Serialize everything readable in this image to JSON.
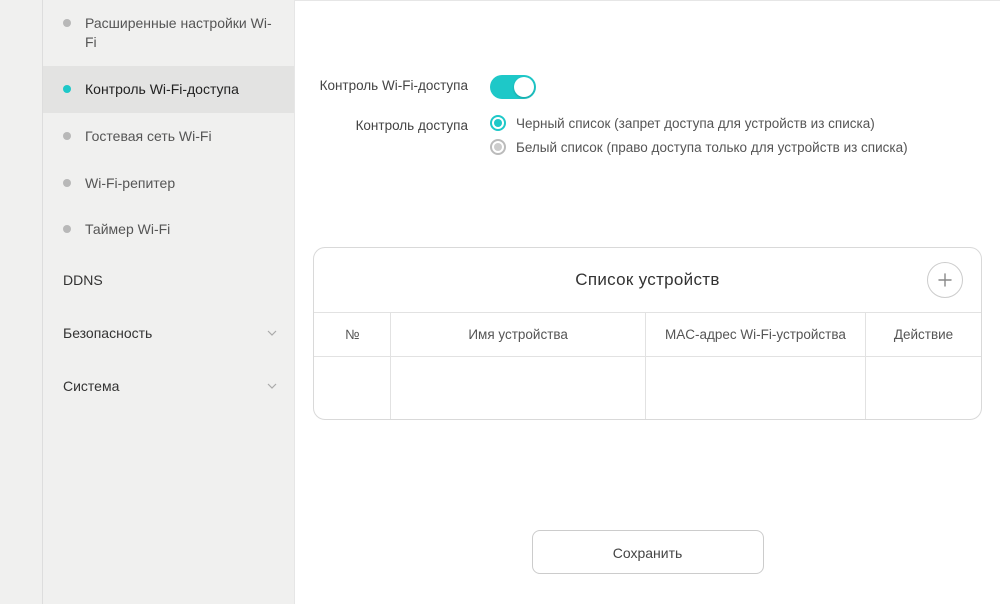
{
  "sidebar": {
    "items": [
      {
        "label": "Расширенные настройки Wi-Fi",
        "active": false
      },
      {
        "label": "Контроль Wi-Fi-доступа",
        "active": true
      },
      {
        "label": "Гостевая сеть Wi-Fi",
        "active": false
      },
      {
        "label": "Wi-Fi-репитер",
        "active": false
      },
      {
        "label": "Таймер Wi-Fi",
        "active": false
      }
    ],
    "sections": [
      {
        "label": "DDNS",
        "hasChevron": false
      },
      {
        "label": "Безопасность",
        "hasChevron": true
      },
      {
        "label": "Система",
        "hasChevron": true
      }
    ]
  },
  "form": {
    "toggleLabel": "Контроль Wi-Fi-доступа",
    "toggleOn": true,
    "modeLabel": "Контроль доступа",
    "options": [
      {
        "label": "Черный список (запрет доступа для устройств из списка)",
        "selected": true
      },
      {
        "label": "Белый список (право доступа только для устройств из списка)",
        "selected": false
      }
    ]
  },
  "panel": {
    "title": "Список устройств",
    "columns": [
      "№",
      "Имя устройства",
      "MAC-адрес Wi-Fi-устройства",
      "Действие"
    ]
  },
  "actions": {
    "save": "Сохранить"
  }
}
